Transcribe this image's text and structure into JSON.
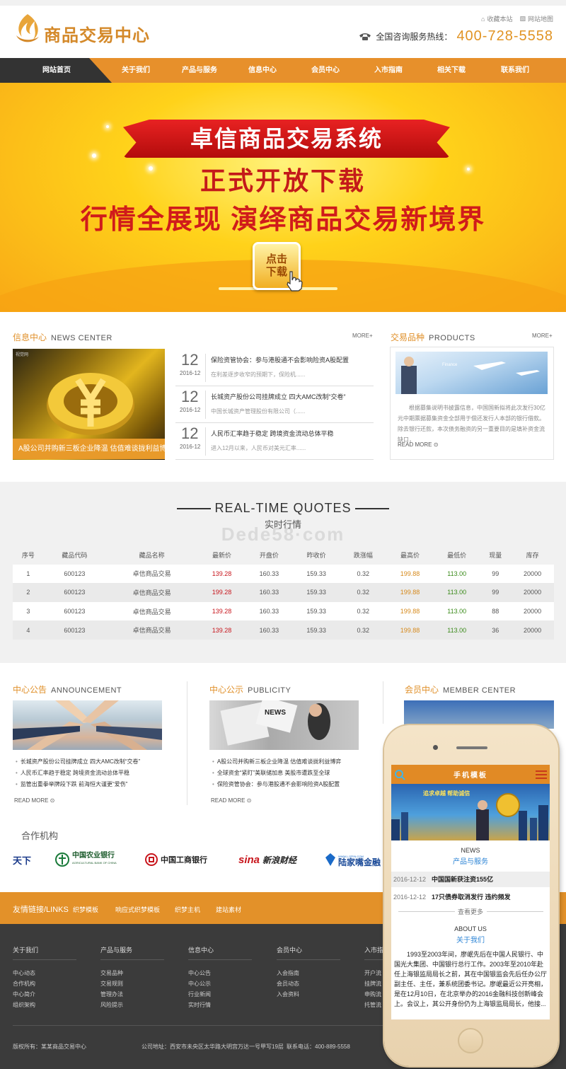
{
  "header": {
    "logo_text": "商品交易中心",
    "bookmark": "收藏本站",
    "sitemap": "网站地图",
    "hotline_label": "全国咨询服务热线：",
    "hotline_number": "400-728-5558"
  },
  "nav": {
    "items": [
      "网站首页",
      "关于我们",
      "产品与服务",
      "信息中心",
      "会员中心",
      "入市指南",
      "相关下载",
      "联系我们"
    ]
  },
  "banner": {
    "ribbon": "卓信商品交易系统",
    "line1": "正式开放下载",
    "line2": "行情全展现 演绎商品交易新境界",
    "button_line1": "点击",
    "button_line2": "下载"
  },
  "news": {
    "title_cn": "信息中心",
    "title_en": "NEWS CENTER",
    "more": "MORE+",
    "image_caption": "A股公司并购新三板企业降温 估值难谈拢利益博弈",
    "items": [
      {
        "day": "12",
        "month": "2016-12",
        "title": "保险资管协会：参与港股通不会影响险资A股配置",
        "desc": "在利差逐步收窄的预期下，保险机......"
      },
      {
        "day": "12",
        "month": "2016-12",
        "title": "长城资产股份公司挂牌成立 四大AMC改制“交卷”",
        "desc": "中国长城资产管理股份有限公司（......"
      },
      {
        "day": "12",
        "month": "2016-12",
        "title": "人民币汇率趋于稳定 跨境资金流动总体平稳",
        "desc": "进入12月以来，人民币对美元汇率......"
      }
    ]
  },
  "products": {
    "title_cn": "交易品种",
    "title_en": "PRODUCTS",
    "more": "MORE+",
    "image_text": "Finance",
    "desc": "根据募集说明书披露信息，中国国新拟将此次发行30亿元中期票据募集资金全部用于偿还发行人本部的银行借款。除去银行还款，本次债务融资的另一重要目的是填补资金流缺口，",
    "read_more": "READ MORE"
  },
  "quotes": {
    "title_en": "REAL-TIME QUOTES",
    "title_cn": "实时行情",
    "watermark": "Dede58·com",
    "headers": [
      "序号",
      "藏品代码",
      "藏品名称",
      "最新价",
      "开盘价",
      "昨收价",
      "跌涨幅",
      "最高价",
      "最低价",
      "现量",
      "库存"
    ],
    "rows": [
      [
        "1",
        "600123",
        "卓信商品交易",
        "139.28",
        "160.33",
        "159.33",
        "0.32",
        "199.88",
        "113.00",
        "99",
        "20000"
      ],
      [
        "2",
        "600123",
        "卓信商品交易",
        "199.28",
        "160.33",
        "159.33",
        "0.32",
        "199.88",
        "113.00",
        "99",
        "20000"
      ],
      [
        "3",
        "600123",
        "卓信商品交易",
        "139.28",
        "160.33",
        "159.33",
        "0.32",
        "199.88",
        "113.00",
        "88",
        "20000"
      ],
      [
        "4",
        "600123",
        "卓信商品交易",
        "139.28",
        "160.33",
        "159.33",
        "0.32",
        "199.88",
        "113.00",
        "36",
        "20000"
      ]
    ]
  },
  "announcement": {
    "title_cn": "中心公告",
    "title_en": "ANNOUNCEMENT",
    "items": [
      "长城资产股份公司挂牌成立 四大AMC改制“交卷”",
      "人民币汇率趋于稳定 跨境资金流动总体平稳",
      "监管出重拳举牌段下跌 前海恒大谨更“爱伤”"
    ],
    "read_more": "READ MORE"
  },
  "publicity": {
    "title_cn": "中心公示",
    "title_en": "PUBLICITY",
    "image_text": "NEWS",
    "items": [
      "A股公司并购新三板企业降温 估值难谈拢利益博弈",
      "全球资金“紧盯”美联储加息 美股市遭跌至全球",
      "保险资管协会：参与港股通不会影响险资A股配置"
    ],
    "read_more": "READ MORE"
  },
  "member": {
    "title_cn": "会员中心",
    "title_en": "MEMBER CENTER"
  },
  "partners": {
    "title": "合作机构",
    "items": [
      "天下",
      "中国农业银行",
      "中国工商银行",
      "新浪财经",
      "陆家嘴金融"
    ],
    "abc_en": "AGRICULTURAL BANK OF CHINA",
    "sina_mark": "sina",
    "ljz_url": "WWW.LJZFIN.COM"
  },
  "links": {
    "label": "友情链接/LINKS",
    "items": [
      "织梦模板",
      "响应式织梦模板",
      "织梦主机",
      "建站素材"
    ]
  },
  "footer": {
    "columns": [
      {
        "title": "关于我们",
        "items": [
          "中心动态",
          "合作机构",
          "中心简介",
          "组织架构"
        ]
      },
      {
        "title": "产品与服务",
        "items": [
          "交易品种",
          "交易规则",
          "管理办法",
          "风险提示"
        ]
      },
      {
        "title": "信息中心",
        "items": [
          "中心公告",
          "中心公示",
          "行业新闻",
          "实时行情"
        ]
      },
      {
        "title": "会员中心",
        "items": [
          "入会指南",
          "会员动态",
          "入会资料"
        ]
      },
      {
        "title": "入市指",
        "items": [
          "开户流",
          "挂牌流",
          "申购流",
          "托管流"
        ]
      }
    ],
    "copyright": "版权所有：某某商品交易中心",
    "address": "公司地址：西安市未央区太华路大明宫万达一号甲写19层",
    "tel": "联系电话：400-889-5558"
  },
  "mobile": {
    "title": "手机模板",
    "banner_text": "追求卓越 帮助诚信",
    "news_en": "NEWS",
    "news_cn": "产品与服务",
    "news": [
      {
        "date": "2016-12-12",
        "title": "中国国新获注资155亿"
      },
      {
        "date": "2016-12-12",
        "title": "17只债券取消发行 违约频发"
      }
    ],
    "more": "查看更多",
    "about_en": "ABOUT US",
    "about_cn": "关于我们",
    "about_text": "1993至2003年间，廖岷先后在中国人民银行、中国光大集团、中国银行总行工作。2003年至2010年赴任上海银监局局长之前，其在中国银监会先后任办公厅副主任、主任，兼系统团委书记。廖岷最近公开亮相，是在12月10日，在北京举办的2016金融科技创新峰会上。会议上，其公开身份仍为上海银监局局长，他接..."
  }
}
